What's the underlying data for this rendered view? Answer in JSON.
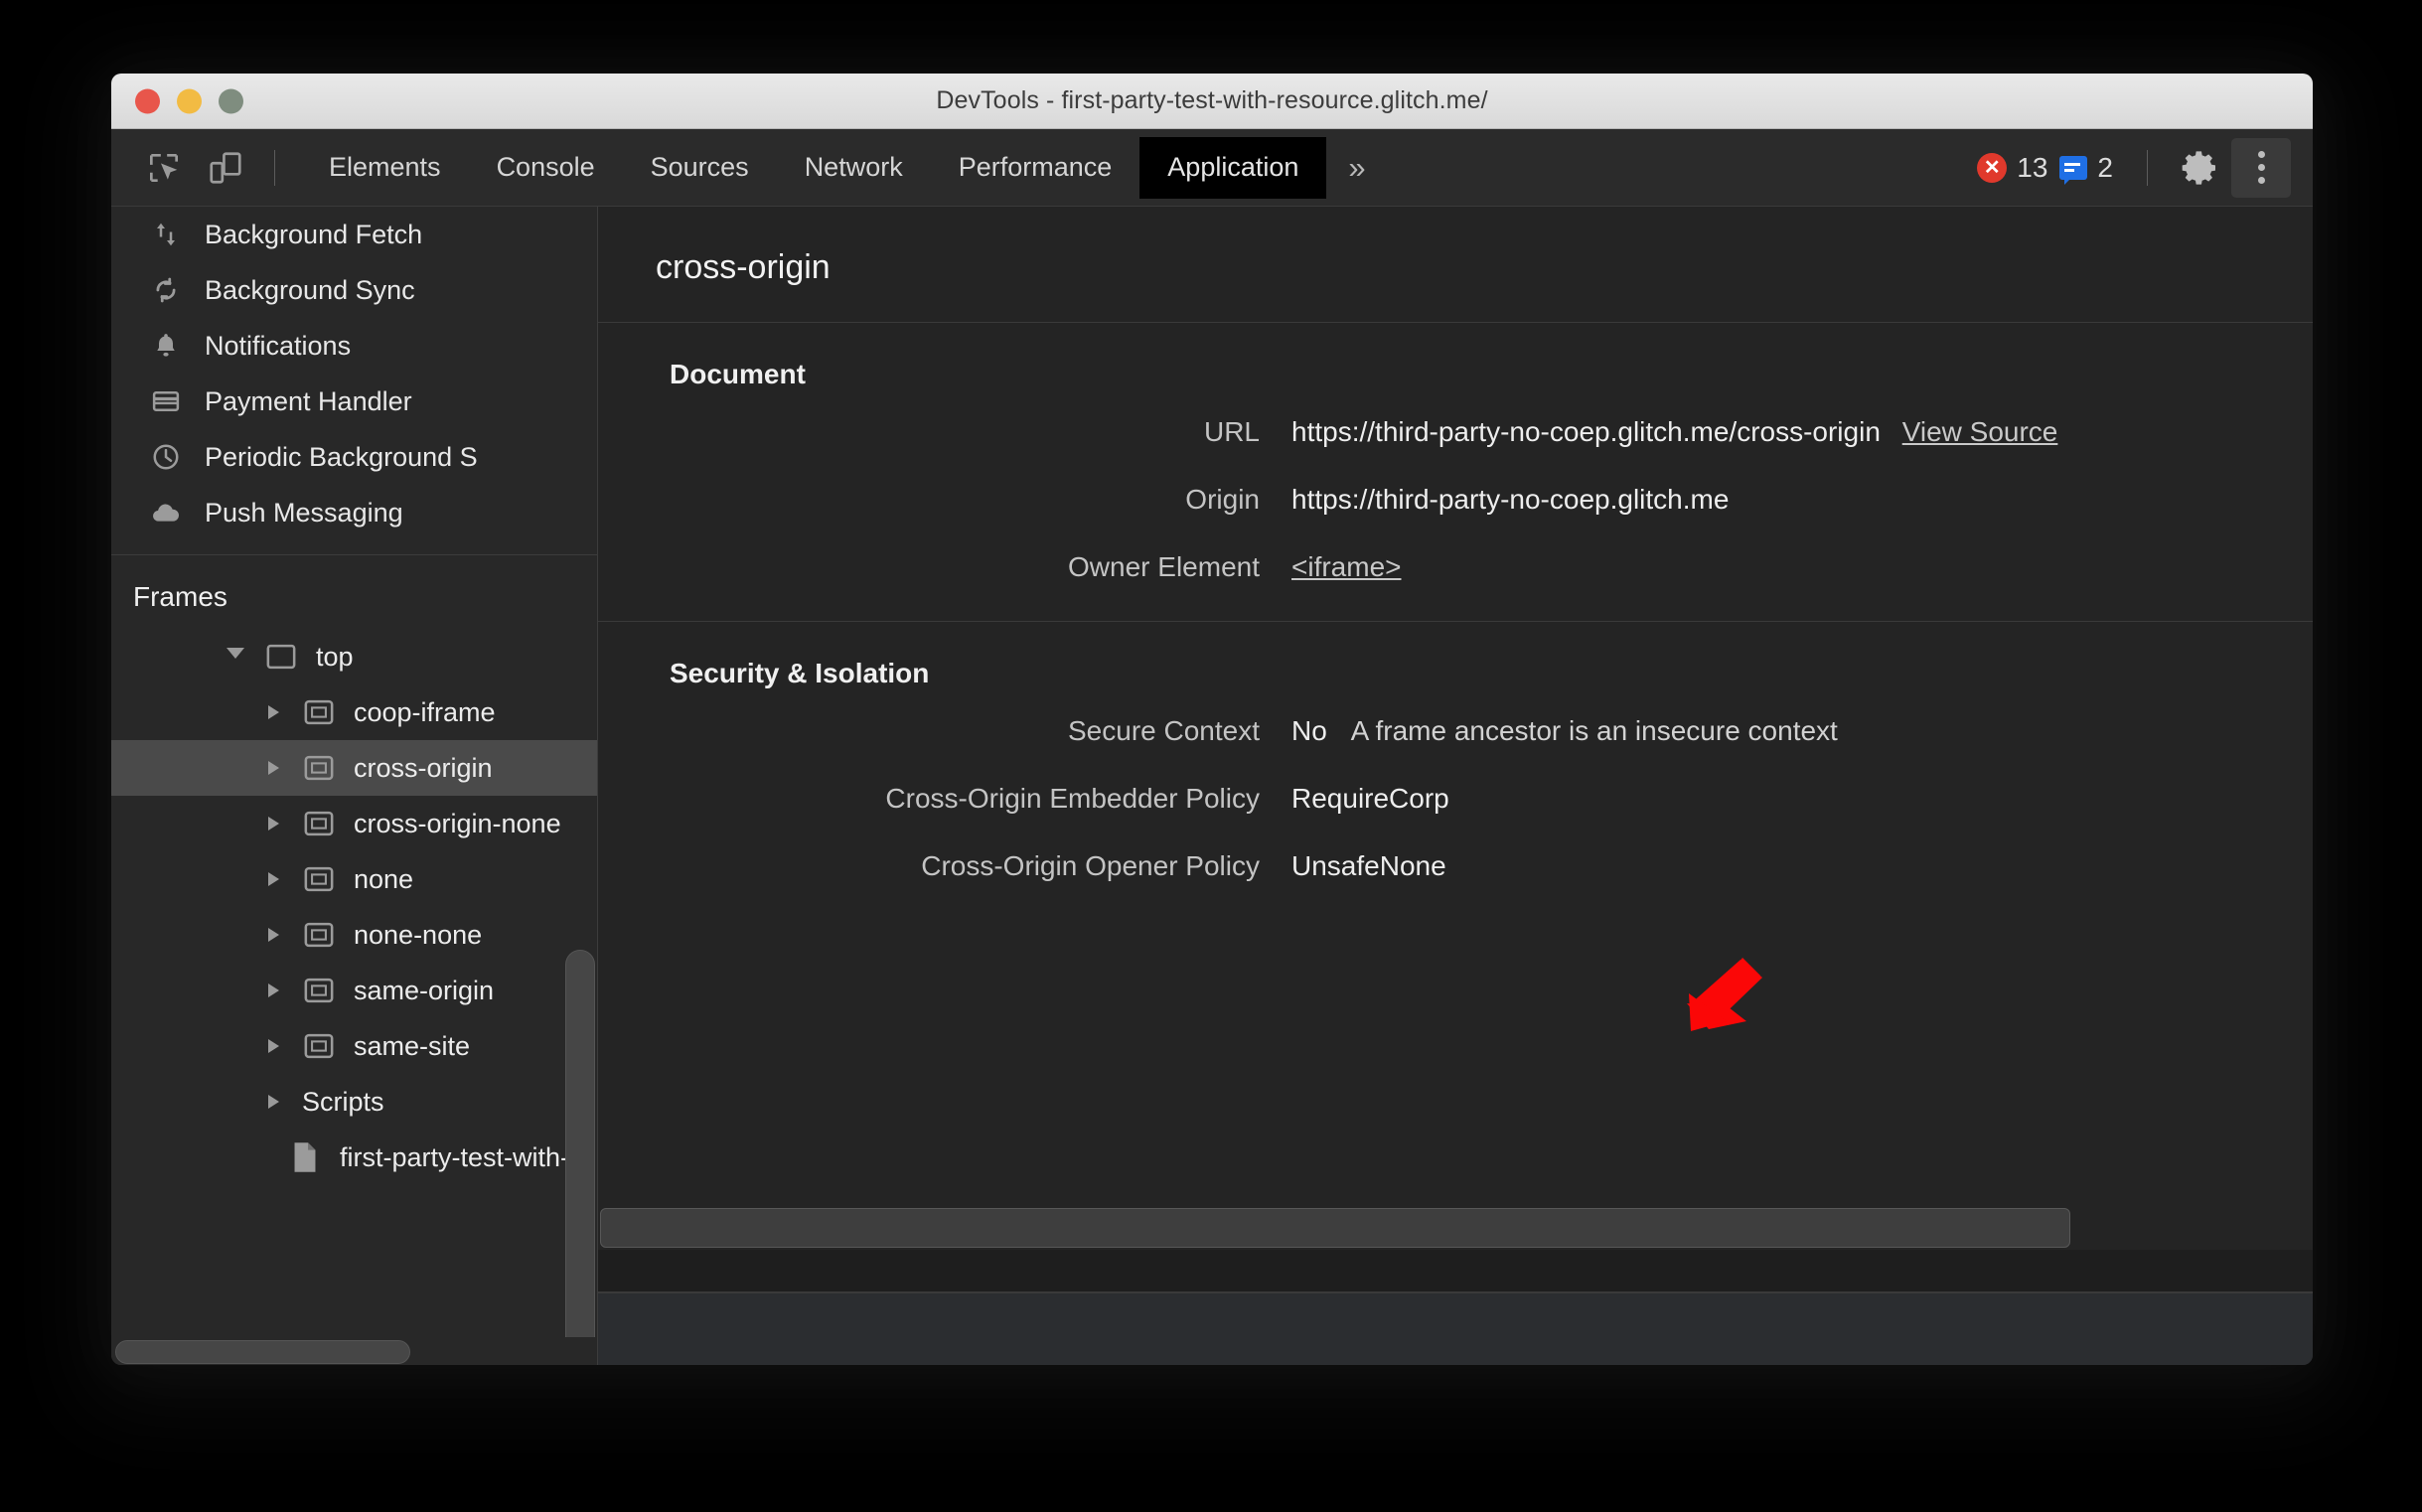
{
  "window": {
    "title": "DevTools - first-party-test-with-resource.glitch.me/"
  },
  "toolbar": {
    "inspect_icon": "inspect-element-icon",
    "device_icon": "device-toolbar-icon",
    "tabs": [
      {
        "label": "Elements",
        "active": false
      },
      {
        "label": "Console",
        "active": false
      },
      {
        "label": "Sources",
        "active": false
      },
      {
        "label": "Network",
        "active": false
      },
      {
        "label": "Performance",
        "active": false
      },
      {
        "label": "Application",
        "active": true
      }
    ],
    "more_tabs_label": "»",
    "error_badge": {
      "icon": "error-icon",
      "glyph": "✕",
      "count": "13",
      "color": "#e0392c"
    },
    "message_badge": {
      "icon": "message-icon",
      "count": "2",
      "color": "#1f6fe5"
    },
    "settings_icon": "gear-icon",
    "menu_icon": "vertical-dots-icon"
  },
  "sidebar": {
    "background_services": [
      {
        "label": "Background Fetch",
        "icon": "background-fetch-icon"
      },
      {
        "label": "Background Sync",
        "icon": "background-sync-icon"
      },
      {
        "label": "Notifications",
        "icon": "bell-icon"
      },
      {
        "label": "Payment Handler",
        "icon": "credit-card-icon"
      },
      {
        "label": "Periodic Background S",
        "icon": "clock-icon"
      },
      {
        "label": "Push Messaging",
        "icon": "cloud-icon"
      }
    ],
    "frames_section_title": "Frames",
    "frames_tree": [
      {
        "label": "top",
        "icon": "frame-icon",
        "twisty": "open",
        "depth": 1,
        "selected": false
      },
      {
        "label": "coop-iframe",
        "icon": "iframe-icon",
        "twisty": "closed",
        "depth": 2,
        "selected": false
      },
      {
        "label": "cross-origin",
        "icon": "iframe-icon",
        "twisty": "closed",
        "depth": 2,
        "selected": true
      },
      {
        "label": "cross-origin-none",
        "icon": "iframe-icon",
        "twisty": "closed",
        "depth": 2,
        "selected": false
      },
      {
        "label": "none",
        "icon": "iframe-icon",
        "twisty": "closed",
        "depth": 2,
        "selected": false
      },
      {
        "label": "none-none",
        "icon": "iframe-icon",
        "twisty": "closed",
        "depth": 2,
        "selected": false
      },
      {
        "label": "same-origin",
        "icon": "iframe-icon",
        "twisty": "closed",
        "depth": 2,
        "selected": false
      },
      {
        "label": "same-site",
        "icon": "iframe-icon",
        "twisty": "closed",
        "depth": 2,
        "selected": false
      },
      {
        "label": "Scripts",
        "icon": "none",
        "twisty": "closed",
        "depth": 1.5,
        "selected": false
      },
      {
        "label": "first-party-test-with-",
        "icon": "document-icon",
        "twisty": "none",
        "depth": 2,
        "selected": false
      }
    ]
  },
  "main": {
    "frame_title": "cross-origin",
    "sections": [
      {
        "heading": "Document",
        "rows": [
          {
            "key": "URL",
            "value": "https://third-party-no-coep.glitch.me/cross-origin",
            "link": "View Source"
          },
          {
            "key": "Origin",
            "value": "https://third-party-no-coep.glitch.me",
            "link": ""
          },
          {
            "key": "Owner Element",
            "value": "",
            "link_value": "<iframe>"
          }
        ]
      },
      {
        "heading": "Security & Isolation",
        "rows": [
          {
            "key": "Secure Context",
            "value": "No",
            "extra": "A frame ancestor is an insecure context"
          },
          {
            "key": "Cross-Origin Embedder Policy",
            "value": "RequireCorp"
          },
          {
            "key": "Cross-Origin Opener Policy",
            "value": "UnsafeNone"
          }
        ]
      }
    ]
  },
  "annotation": {
    "arrow_color": "#fb0707",
    "arrow_direction": "down-left",
    "points_at": "Security & Isolation"
  }
}
